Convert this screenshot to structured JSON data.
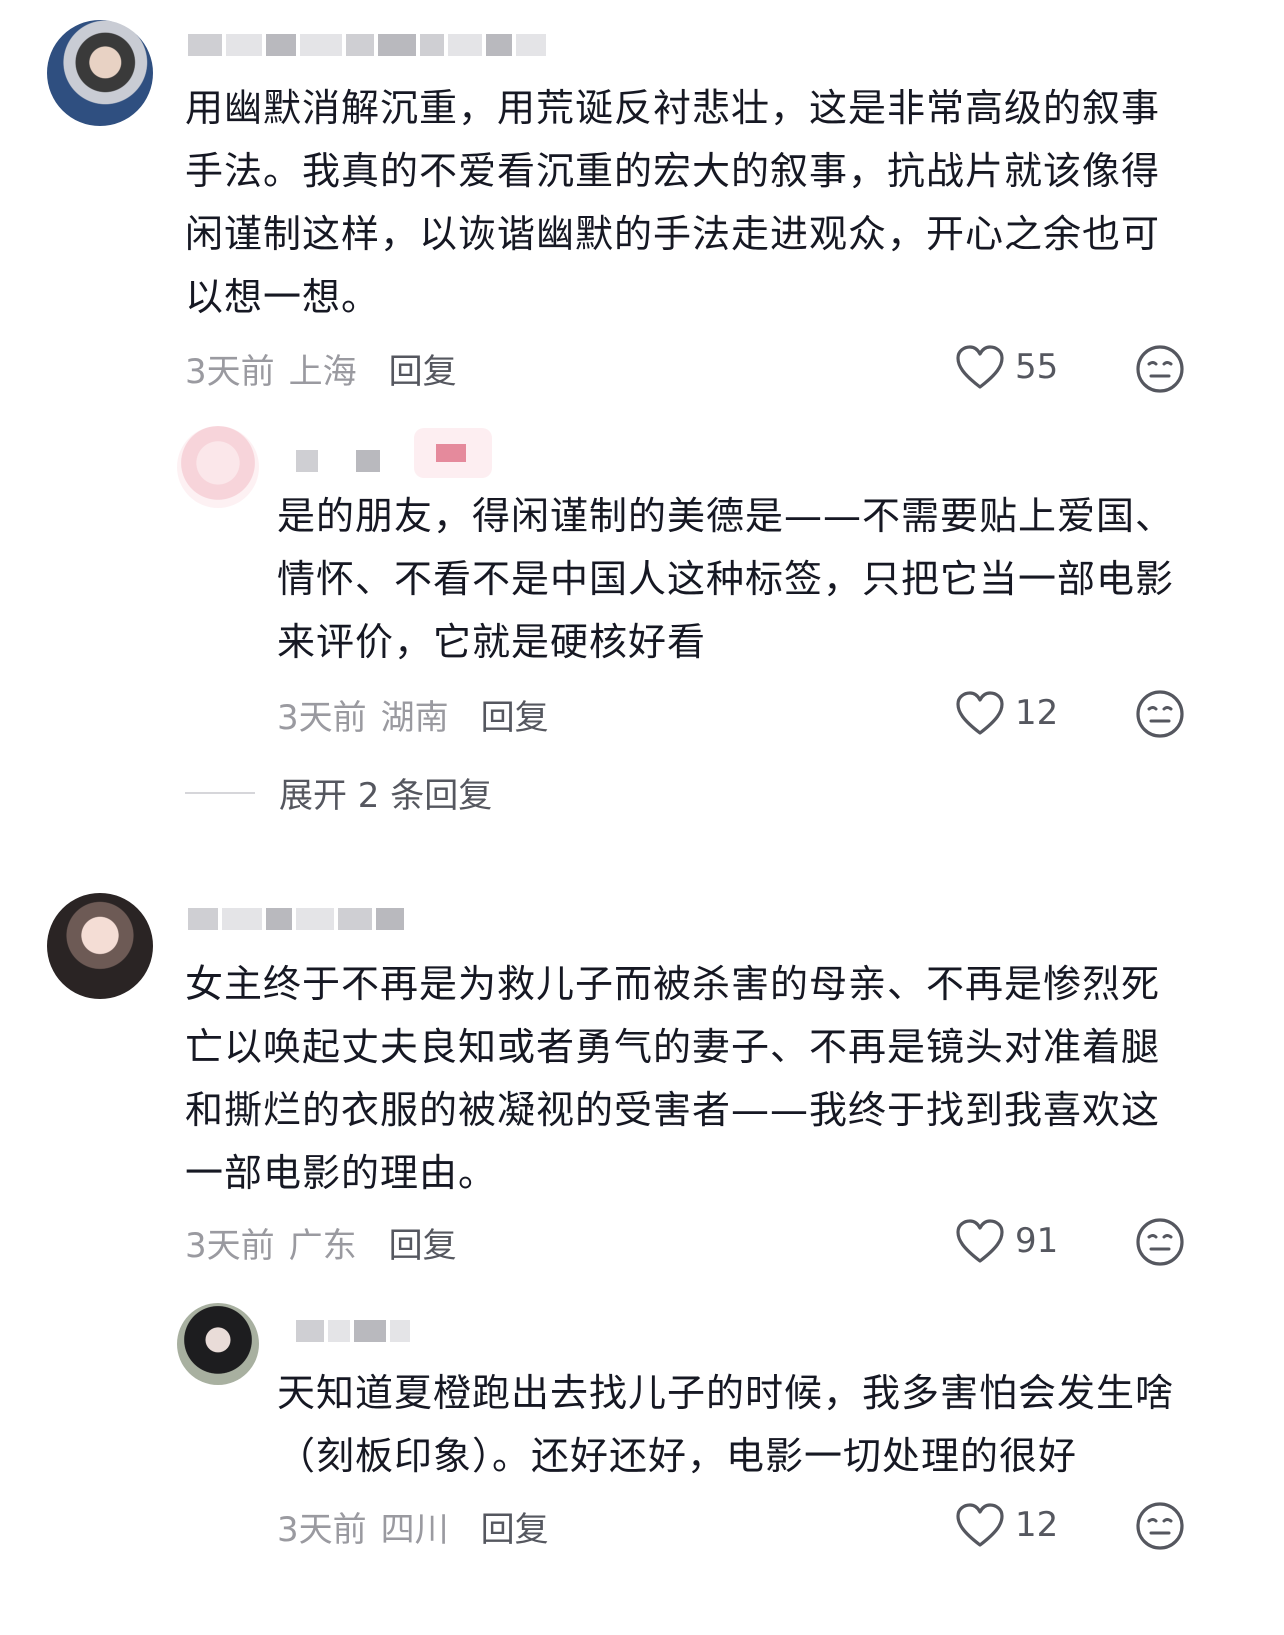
{
  "comments": [
    {
      "text": "用幽默消解沉重，用荒诞反衬悲壮，这是非常高级的叙事手法。我真的不爱看沉重的宏大的叙事，抗战片就该像得闲谨制这样，以诙谐幽默的手法走进观众，开心之余也可以想一想。",
      "time": "3天前",
      "location": "上海",
      "reply_label": "回复",
      "likes": "55",
      "reply": {
        "text": "是的朋友，得闲谨制的美德是——不需要贴上爱国、情怀、不看不是中国人这种标签，只把它当一部电影来评价，它就是硬核好看",
        "time": "3天前",
        "location": "湖南",
        "reply_label": "回复",
        "likes": "12"
      },
      "expand_label": "展开 2 条回复"
    },
    {
      "text": "女主终于不再是为救儿子而被杀害的母亲、不再是惨烈死亡以唤起丈夫良知或者勇气的妻子、不再是镜头对准着腿和撕烂的衣服的被凝视的受害者——我终于找到我喜欢这一部电影的理由。",
      "time": "3天前",
      "location": "广东",
      "reply_label": "回复",
      "likes": "91",
      "reply": {
        "text": "天知道夏橙跑出去找儿子的时候，我多害怕会发生啥（刻板印象）。还好还好，电影一切处理的很好",
        "time": "3天前",
        "location": "四川",
        "reply_label": "回复",
        "likes": "12"
      }
    }
  ],
  "icons": {
    "like": "heart-outline-icon",
    "dislike": "neutral-face-icon"
  },
  "colors": {
    "text": "#161823",
    "meta": "#9a9aa0",
    "action": "#55575f"
  }
}
